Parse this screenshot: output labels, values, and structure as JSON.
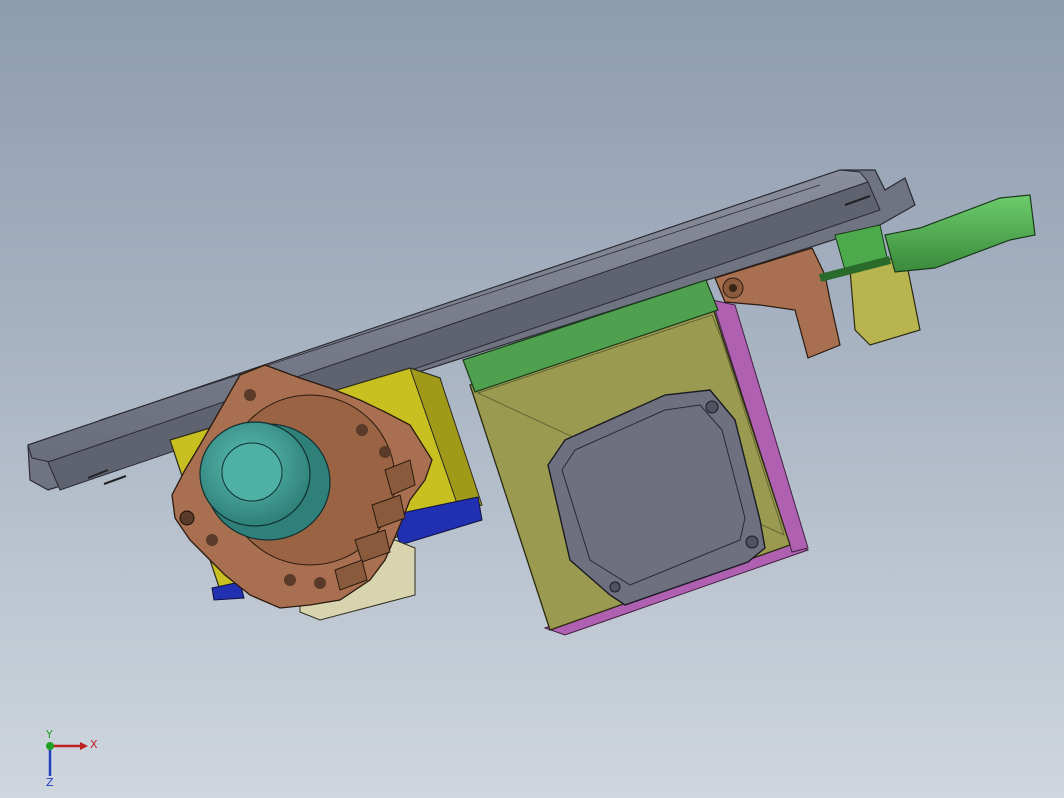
{
  "viewport": {
    "background_top": "#8d9caf",
    "background_bottom": "#cfd6de"
  },
  "model": {
    "colors": {
      "rail": "#6f7382",
      "bracket_yellow": "#c8c020",
      "motor_plate": "#9a9a50",
      "green_strip": "#4fa04f",
      "green_rod": "#4caa4c",
      "copper": "#a87050",
      "teal_shaft": "#3f9a90",
      "stepper_body": "#6e7080",
      "blue_block": "#2030b0",
      "magenta_edge": "#b060b0",
      "cream_block": "#d8d4b0",
      "yellow_small": "#b8b450"
    }
  },
  "triad": {
    "x_label": "X",
    "y_label": "Y",
    "z_label": "Z",
    "x_color": "#c02020",
    "y_color": "#20a020",
    "z_color": "#2040c0"
  }
}
